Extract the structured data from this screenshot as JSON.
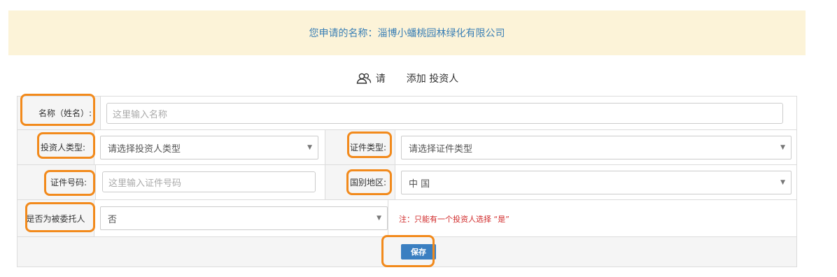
{
  "banner": {
    "text": "您申请的名称：淄博小蟠桃园林绿化有限公司"
  },
  "subtitle": {
    "prefix": "请",
    "text": "添加 投资人"
  },
  "form": {
    "name": {
      "label": "名称（姓名）:",
      "placeholder": "这里输入名称"
    },
    "investor_type": {
      "label": "投资人类型:",
      "value": "请选择投资人类型"
    },
    "id_type": {
      "label": "证件类型:",
      "value": "请选择证件类型"
    },
    "id_number": {
      "label": "证件号码:",
      "placeholder": "这里输入证件号码"
    },
    "region": {
      "label": "国别地区:",
      "value": "中 国"
    },
    "entrusted": {
      "label": "是否为被委托人",
      "value": "否"
    },
    "note": "注：只能有一个投资人选择 “是”",
    "save_label": "保存"
  },
  "colors": {
    "accent": "#f28a1c",
    "banner_bg": "#fcf3d8",
    "banner_text": "#3a7fb5",
    "button": "#3a7fc1",
    "note": "#d12b2b"
  },
  "icons": {
    "subtitle": "users-icon",
    "select_arrow": "caret-down-icon"
  }
}
